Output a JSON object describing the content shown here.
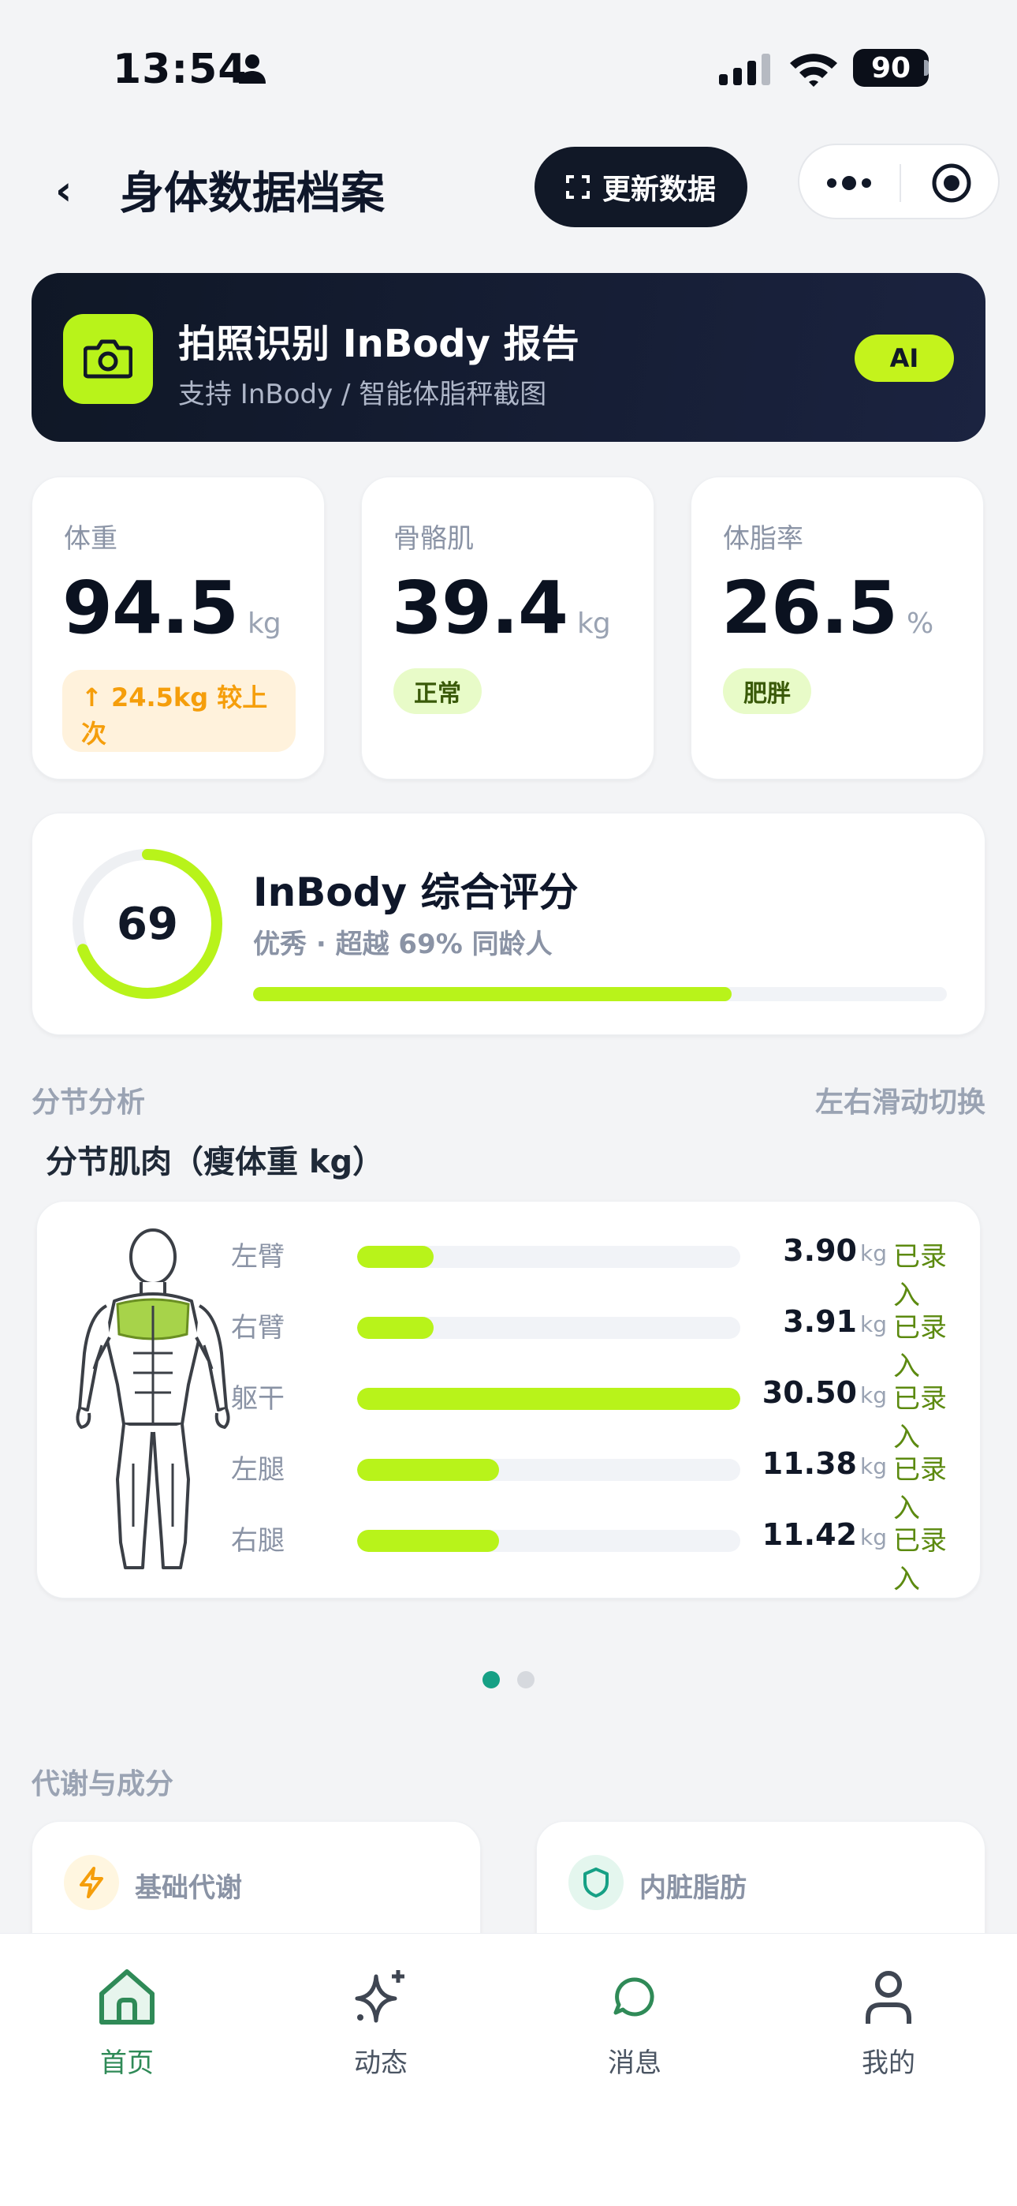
{
  "status_bar": {
    "time": "13:54",
    "battery": "90"
  },
  "header": {
    "title": "身体数据档案",
    "update_label": "更新数据"
  },
  "ai_banner": {
    "title": "拍照识别 InBody 报告",
    "subtitle": "支持 InBody / 智能体脂秤截图",
    "badge": "AI"
  },
  "metrics": [
    {
      "label": "体重",
      "value": "94.5",
      "unit": "kg",
      "tag": "↑ 24.5kg 较上次",
      "tag_style": "warning"
    },
    {
      "label": "骨骼肌",
      "value": "39.4",
      "unit": "kg",
      "tag": "正常",
      "tag_style": "normal"
    },
    {
      "label": "体脂率",
      "value": "26.5",
      "unit": "%",
      "tag": "肥胖",
      "tag_style": "normal"
    }
  ],
  "score": {
    "value": "69",
    "title": "InBody 综合评分",
    "subtitle": "优秀 · 超越 69% 同龄人",
    "percent": 69
  },
  "segment": {
    "section_label": "分节分析",
    "hint": "左右滑动切换",
    "title": "分节肌肉（瘦体重 kg）",
    "unit": "kg",
    "rows": [
      {
        "name": "左臂",
        "value": "3.90",
        "fill": 0.2,
        "status": "已录入"
      },
      {
        "name": "右臂",
        "value": "3.91",
        "fill": 0.2,
        "status": "已录入"
      },
      {
        "name": "躯干",
        "value": "30.50",
        "fill": 1.0,
        "status": "已录入"
      },
      {
        "name": "左腿",
        "value": "11.38",
        "fill": 0.37,
        "status": "已录入"
      },
      {
        "name": "右腿",
        "value": "11.42",
        "fill": 0.37,
        "status": "已录入"
      }
    ]
  },
  "pager": {
    "active": 0,
    "count": 2
  },
  "metabolism": {
    "section_label": "代谢与成分",
    "cards": [
      {
        "title": "基础代谢",
        "icon": "lightning-icon"
      },
      {
        "title": "内脏脂肪",
        "icon": "shield-icon"
      }
    ]
  },
  "tabs": [
    {
      "label": "首页",
      "icon": "home-icon",
      "active": true
    },
    {
      "label": "动态",
      "icon": "sparkle-icon",
      "active": false
    },
    {
      "label": "消息",
      "icon": "chat-icon",
      "active": false
    },
    {
      "label": "我的",
      "icon": "profile-icon",
      "active": false
    }
  ],
  "colors": {
    "accent": "#b8f31a",
    "dark": "#111827",
    "active_tab": "#2f8a57",
    "warning": "#f59e0b",
    "pager_active": "#16a085"
  }
}
